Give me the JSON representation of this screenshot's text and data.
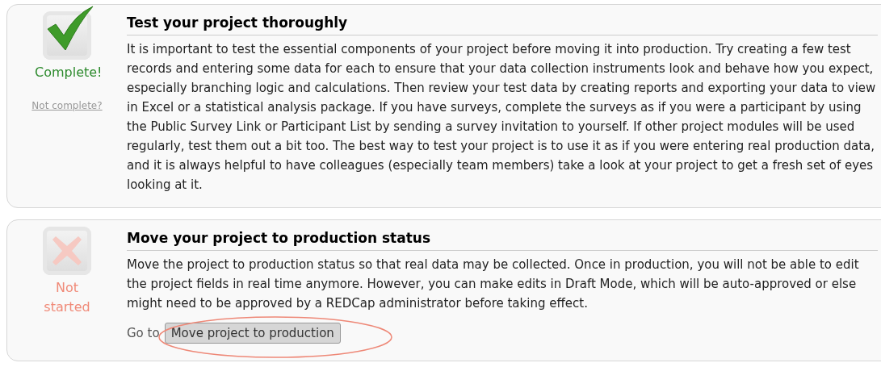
{
  "steps": [
    {
      "kind": "complete",
      "status_label": "Complete!",
      "undo_link": "Not complete?",
      "title": "Test your project thoroughly",
      "description": "It is important to test the essential components of your project before moving it into production. Try creating a few test records and entering some data for each to ensure that your data collection instruments look and behave how you expect, especially branching logic and calculations. Then review your test data by creating reports and exporting your data to view in Excel or a statistical analysis package. If you have surveys, complete the surveys as if you were a participant by using the Public Survey Link or Participant List by sending a survey invitation to yourself. If other project modules will be used regularly, test them out a bit too. The best way to test your project is to use it as if you were entering real production data, and it is always helpful to have colleagues (especially team members) take a look at your project to get a fresh set of eyes looking at it."
    },
    {
      "kind": "not_started",
      "status_label": "Not started",
      "title": "Move your project to production status",
      "description": "Move the project to production status so that real data may be collected. Once in production, you will not be able to edit the project fields in real time anymore. However, you can make edits in Draft Mode, which will be auto-approved or else might need to be approved by a REDCap administrator before taking effect.",
      "action": {
        "prefix": "Go to",
        "button": "Move project to production",
        "highlighted": true
      }
    }
  ]
}
